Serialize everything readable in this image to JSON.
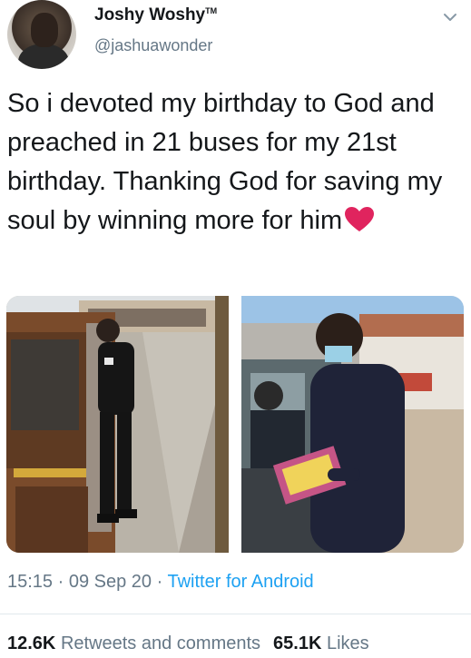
{
  "user": {
    "display_name": "Joshy Woshy",
    "badge": "TM",
    "handle": "@jashuawonder"
  },
  "tweet": {
    "text": "So i devoted my birthday to God and preached in 21 buses for my 21st birthday. Thanking God for saving my soul by winning more for him",
    "emoji": "red-heart-icon"
  },
  "photos": [
    "photo-man-preaching-at-bus-door",
    "photo-man-holding-book-beside-van"
  ],
  "meta": {
    "time": "15:15",
    "separator": "·",
    "date": "09 Sep 20",
    "source": "Twitter for Android"
  },
  "stats": {
    "retweets_count": "12.6K",
    "retweets_label": "Retweets and comments",
    "likes_count": "65.1K",
    "likes_label": "Likes"
  },
  "colors": {
    "text": "#14171a",
    "secondary": "#657786",
    "link": "#1da1f2",
    "heart": "#e0245e"
  }
}
